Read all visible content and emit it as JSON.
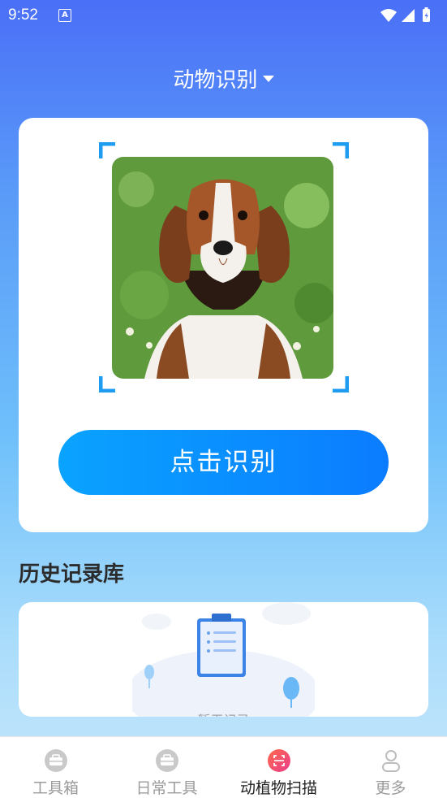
{
  "status_bar": {
    "time": "9:52",
    "notification_icon_letter": "A"
  },
  "header": {
    "title": "动物识别"
  },
  "scan_card": {
    "image": "beagle-puppy-photo",
    "button_label": "点击识别"
  },
  "history": {
    "title": "历史记录库",
    "empty_text": "暂无记录"
  },
  "tabbar": {
    "items": [
      {
        "label": "工具箱",
        "icon": "toolbox-icon",
        "active": false
      },
      {
        "label": "日常工具",
        "icon": "toolbox-icon",
        "active": false
      },
      {
        "label": "动植物扫描",
        "icon": "scan-icon",
        "active": true
      },
      {
        "label": "更多",
        "icon": "person-icon",
        "active": false
      }
    ]
  },
  "colors": {
    "accent": "#0b7cff",
    "active_tab_icon": "#f14b6b",
    "frame_corner": "#1e9cf0"
  }
}
